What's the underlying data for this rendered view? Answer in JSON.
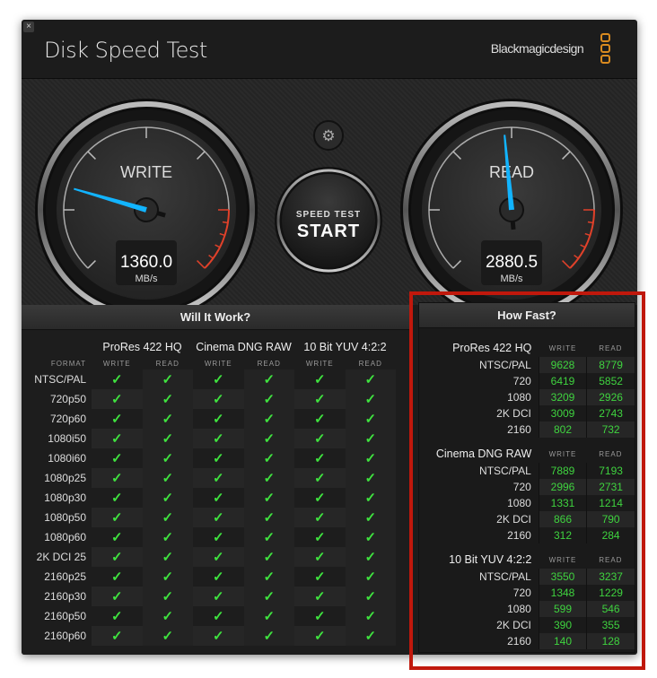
{
  "window": {
    "title": "Disk Speed Test",
    "brand": "Blackmagicdesign",
    "close": "×"
  },
  "gauges": {
    "write": {
      "label": "WRITE",
      "value": 1360.0,
      "value_text": "1360.0",
      "unit": "MB/s"
    },
    "read": {
      "label": "READ",
      "value": 2880.5,
      "value_text": "2880.5",
      "unit": "MB/s"
    },
    "needle_color": "#12b4ff"
  },
  "start_button": {
    "line1": "SPEED TEST",
    "line2": "START"
  },
  "settings": {
    "icon": "gear-icon"
  },
  "will_it_work": {
    "title": "Will It Work?",
    "format_label": "FORMAT",
    "groups": [
      "ProRes 422 HQ",
      "Cinema DNG RAW",
      "10 Bit YUV 4:2:2"
    ],
    "sub": [
      "WRITE",
      "READ"
    ],
    "check": "✓",
    "rows": [
      "NTSC/PAL",
      "720p50",
      "720p60",
      "1080i50",
      "1080i60",
      "1080p25",
      "1080p30",
      "1080p50",
      "1080p60",
      "2K DCI 25",
      "2160p25",
      "2160p30",
      "2160p50",
      "2160p60"
    ]
  },
  "how_fast": {
    "title": "How Fast?",
    "sub": [
      "WRITE",
      "READ"
    ],
    "groups": [
      {
        "name": "ProRes 422 HQ",
        "rows": [
          [
            "NTSC/PAL",
            "9628",
            "8779"
          ],
          [
            "720",
            "6419",
            "5852"
          ],
          [
            "1080",
            "3209",
            "2926"
          ],
          [
            "2K DCI",
            "3009",
            "2743"
          ],
          [
            "2160",
            "802",
            "732"
          ]
        ]
      },
      {
        "name": "Cinema DNG RAW",
        "rows": [
          [
            "NTSC/PAL",
            "7889",
            "7193"
          ],
          [
            "720",
            "2996",
            "2731"
          ],
          [
            "1080",
            "1331",
            "1214"
          ],
          [
            "2K DCI",
            "866",
            "790"
          ],
          [
            "2160",
            "312",
            "284"
          ]
        ]
      },
      {
        "name": "10 Bit YUV 4:2:2",
        "rows": [
          [
            "NTSC/PAL",
            "3550",
            "3237"
          ],
          [
            "720",
            "1348",
            "1229"
          ],
          [
            "1080",
            "599",
            "546"
          ],
          [
            "2K DCI",
            "390",
            "355"
          ],
          [
            "2160",
            "140",
            "128"
          ]
        ]
      }
    ]
  }
}
